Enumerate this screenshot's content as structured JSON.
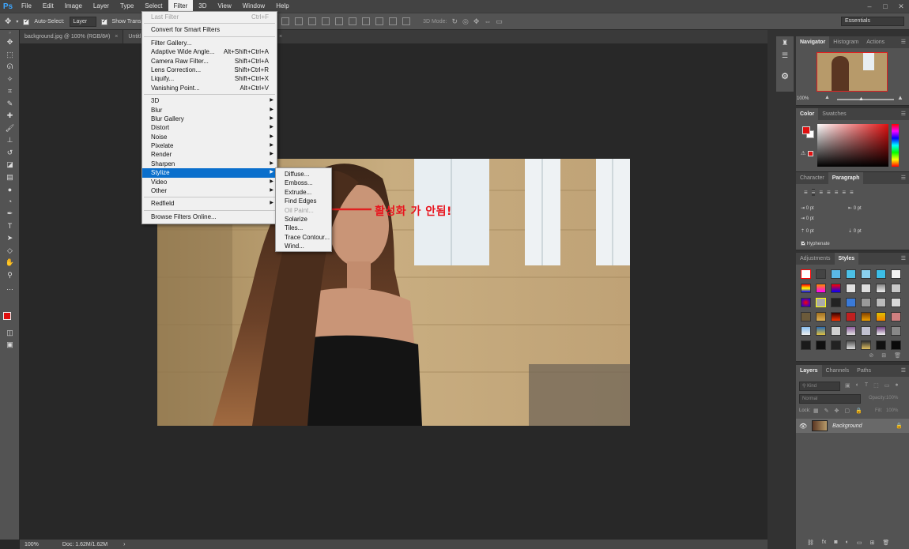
{
  "app": {
    "logo": "Ps"
  },
  "menubar": {
    "items": [
      "File",
      "Edit",
      "Image",
      "Layer",
      "Type",
      "Select",
      "Filter",
      "3D",
      "View",
      "Window",
      "Help"
    ],
    "active": "Filter"
  },
  "options_bar": {
    "auto_select_label": "Auto-Select:",
    "auto_select_value": "Layer",
    "show_transform_label": "Show Transl",
    "mode_3d_label": "3D Mode:",
    "workspace": "Essentials"
  },
  "tabs": [
    {
      "label": "background.jpg @ 100% (RGB/8#)",
      "close": "×"
    },
    {
      "label": "Untitl",
      "close": ""
    },
    {
      "label": "",
      "close": "×"
    }
  ],
  "filter_menu": {
    "last_filter": {
      "label": "Last Filter",
      "shortcut": "Ctrl+F"
    },
    "convert": "Convert for Smart Filters",
    "group1": [
      {
        "label": "Filter Gallery...",
        "shortcut": ""
      },
      {
        "label": "Adaptive Wide Angle...",
        "shortcut": "Alt+Shift+Ctrl+A"
      },
      {
        "label": "Camera Raw Filter...",
        "shortcut": "Shift+Ctrl+A"
      },
      {
        "label": "Lens Correction...",
        "shortcut": "Shift+Ctrl+R"
      },
      {
        "label": "Liquify...",
        "shortcut": "Shift+Ctrl+X"
      },
      {
        "label": "Vanishing Point...",
        "shortcut": "Alt+Ctrl+V"
      }
    ],
    "group2": [
      "3D",
      "Blur",
      "Blur Gallery",
      "Distort",
      "Noise",
      "Pixelate",
      "Render",
      "Sharpen",
      "Stylize",
      "Video",
      "Other"
    ],
    "highlighted": "Stylize",
    "redfield": "Redfield",
    "browse": "Browse Filters Online..."
  },
  "stylize_submenu": {
    "items": [
      "Diffuse...",
      "Emboss...",
      "Extrude...",
      "Find Edges",
      "Oil Paint...",
      "Solarize",
      "Tiles...",
      "Trace Contour...",
      "Wind..."
    ],
    "disabled": "Oil Paint..."
  },
  "annotation": {
    "text": "활성화 가 안됨!",
    "color": "#e8141e"
  },
  "statusbar": {
    "zoom": "100%",
    "doc": "Doc: 1.62M/1.62M",
    "arrow": "›"
  },
  "navigator": {
    "tabs": [
      "Navigator",
      "Histogram",
      "Actions"
    ],
    "zoom": "100%"
  },
  "color_panel": {
    "tabs": [
      "Color",
      "Swatches"
    ],
    "foreground": "#e01010",
    "background": "#ffffff"
  },
  "paragraph_panel": {
    "tabs": [
      "Character",
      "Paragraph"
    ],
    "fields": [
      "0 pt",
      "0 pt",
      "0 pt",
      "0 pt",
      "0 pt"
    ],
    "hyphenate": "Hyphenate"
  },
  "styles_panel": {
    "tabs": [
      "Adjustments",
      "Styles"
    ]
  },
  "layers_panel": {
    "tabs": [
      "Layers",
      "Channels",
      "Paths"
    ],
    "kind_placeholder": "Kind",
    "blend_mode": "Normal",
    "opacity_label": "Opacity:",
    "opacity_value": "100%",
    "lock_label": "Lock:",
    "fill_label": "Fill:",
    "fill_value": "100%",
    "layer_name": "Background"
  },
  "colors": {
    "menu_highlight": "#0a6fcc",
    "panel_bg": "#535353",
    "canvas_bg": "#282828"
  }
}
